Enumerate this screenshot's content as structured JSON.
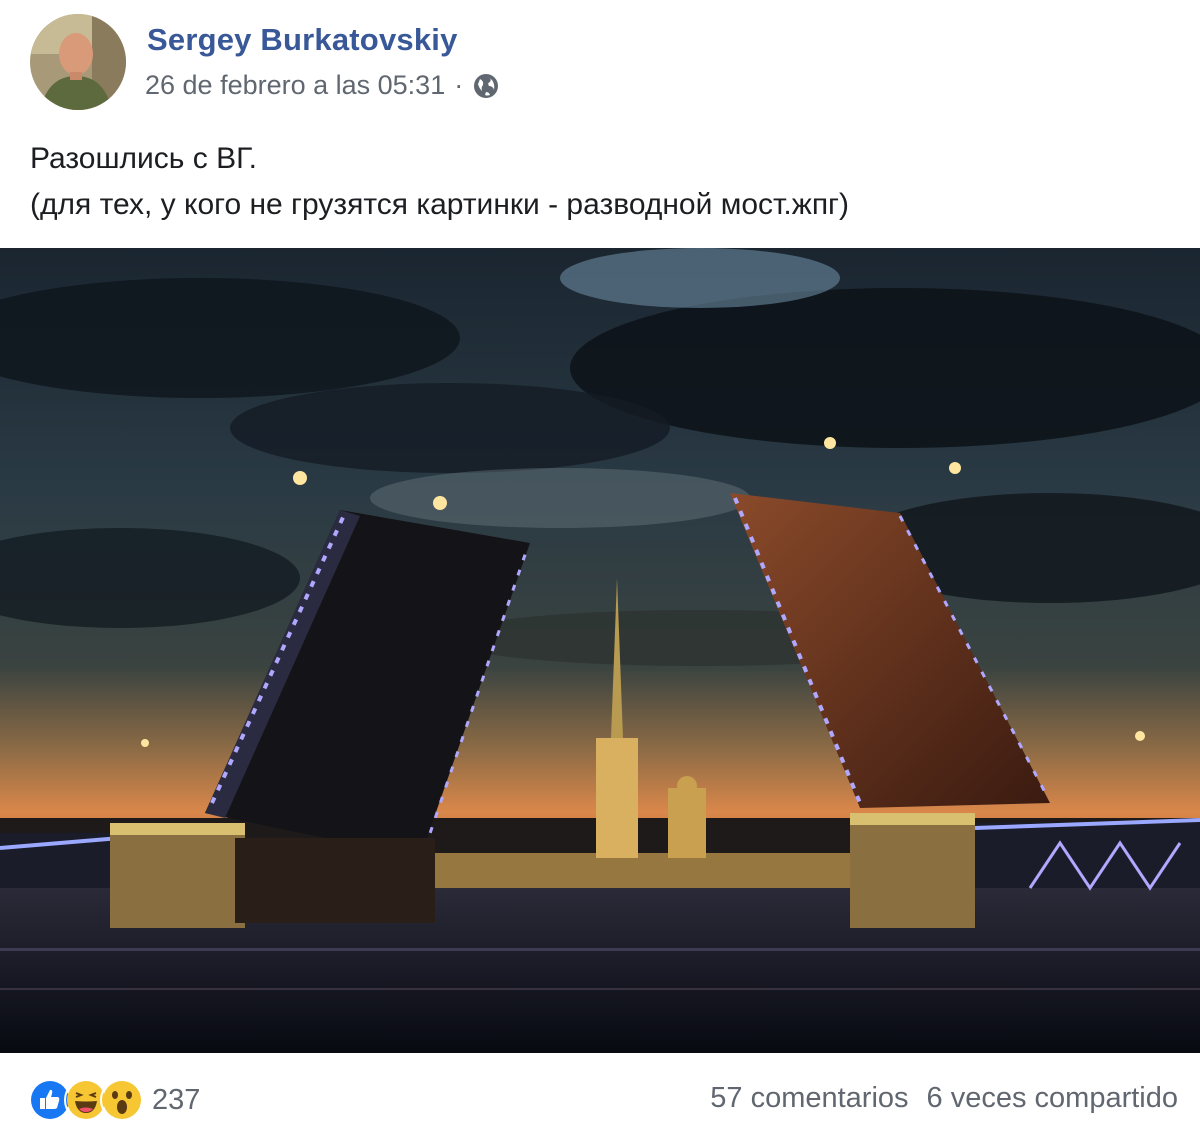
{
  "post": {
    "author": "Sergey Burkatovskiy",
    "timestamp": "26 de febrero a las 05:31",
    "separator": "·",
    "privacy_icon": "globe-icon",
    "text_lines": [
      "Разошлись с ВГ.",
      "(для тех, у кого не грузятся картинки - разводной мост.жпг)"
    ]
  },
  "footer": {
    "reaction_icons": [
      "like-icon",
      "haha-icon",
      "wow-icon"
    ],
    "reaction_count": "237",
    "comments": "57 comentarios",
    "shares": "6 veces compartido"
  },
  "colors": {
    "author_link": "#385898",
    "meta_text": "#616770",
    "like_blue": "#1877f2",
    "emoji_yellow": "#f7c633"
  }
}
